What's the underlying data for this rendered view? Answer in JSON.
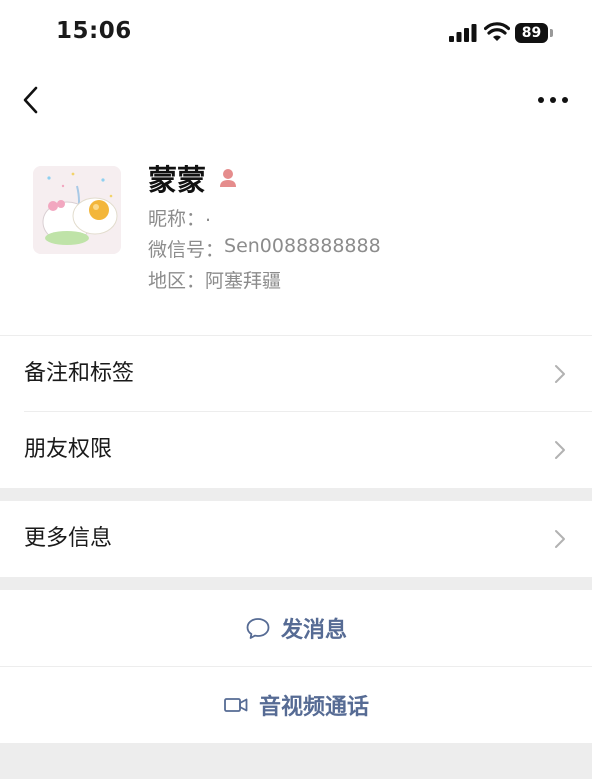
{
  "status_bar": {
    "time": "15:06",
    "battery": "89",
    "icons": [
      "signal-icon",
      "wifi-icon",
      "battery-icon"
    ]
  },
  "nav": {
    "back_icon": "chevron-left-icon",
    "more_icon": "more-dots-icon"
  },
  "profile": {
    "name": "蒙蒙",
    "gender_icon": "female-icon",
    "nickname_key": "昵称：",
    "nickname_value": ".",
    "wechat_id_key": "微信号：",
    "wechat_id_value": "Sen0088888888",
    "region_key": "地区：",
    "region_value": "阿塞拜疆"
  },
  "menu": [
    {
      "label": "备注和标签"
    },
    {
      "label": "朋友权限"
    },
    {
      "label": "更多信息"
    }
  ],
  "actions": {
    "message": "发消息",
    "call": "音视频通话"
  },
  "colors": {
    "action_text": "#566b94",
    "secondary_text": "#8c8c8c",
    "background": "#ededed",
    "gender_icon": "#e58c8c"
  }
}
